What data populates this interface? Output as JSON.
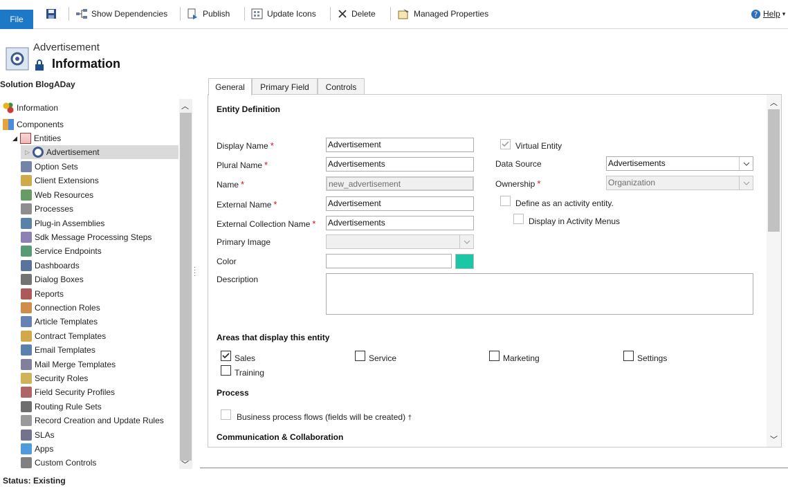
{
  "ribbon": {
    "file": "File",
    "show_dependencies": "Show Dependencies",
    "publish": "Publish",
    "update_icons": "Update Icons",
    "delete": "Delete",
    "managed_properties": "Managed Properties",
    "help": "Help"
  },
  "header": {
    "entity": "Advertisement",
    "title": "Information"
  },
  "solution": "Solution BlogADay",
  "tree": {
    "information": "Information",
    "components": "Components",
    "entities": "Entities",
    "advertisement": "Advertisement",
    "items": [
      "Option Sets",
      "Client Extensions",
      "Web Resources",
      "Processes",
      "Plug-in Assemblies",
      "Sdk Message Processing Steps",
      "Service Endpoints",
      "Dashboards",
      "Dialog Boxes",
      "Reports",
      "Connection Roles",
      "Article Templates",
      "Contract Templates",
      "Email Templates",
      "Mail Merge Templates",
      "Security Roles",
      "Field Security Profiles",
      "Routing Rule Sets",
      "Record Creation and Update Rules",
      "SLAs",
      "Apps",
      "Custom Controls"
    ]
  },
  "tabs": [
    "General",
    "Primary Field",
    "Controls"
  ],
  "form": {
    "entity_definition": "Entity Definition",
    "display_name_label": "Display Name",
    "display_name": "Advertisement",
    "plural_name_label": "Plural Name",
    "plural_name": "Advertisements",
    "name_label": "Name",
    "name": "new_advertisement",
    "external_name_label": "External Name",
    "external_name": "Advertisement",
    "external_collection_label": "External Collection Name",
    "external_collection": "Advertisements",
    "primary_image_label": "Primary Image",
    "color_label": "Color",
    "color_swatch": "#1bc7a4",
    "description_label": "Description",
    "virtual_entity_label": "Virtual Entity",
    "data_source_label": "Data Source",
    "data_source": "Advertisements",
    "ownership_label": "Ownership",
    "ownership": "Organization",
    "activity_entity_label": "Define as an activity entity.",
    "activity_menus_label": "Display in Activity Menus",
    "areas_title": "Areas that display this entity",
    "areas": [
      {
        "label": "Sales",
        "checked": true
      },
      {
        "label": "Service",
        "checked": false
      },
      {
        "label": "Marketing",
        "checked": false
      },
      {
        "label": "Settings",
        "checked": false
      },
      {
        "label": "Training",
        "checked": false
      }
    ],
    "process_title": "Process",
    "bpf_label": "Business process flows (fields will be created)",
    "bpf_mark": "†",
    "comm_title": "Communication & Collaboration"
  },
  "status": "Status: Existing",
  "colors": {
    "accent": "#1e78c8",
    "required": "#d0101b"
  }
}
